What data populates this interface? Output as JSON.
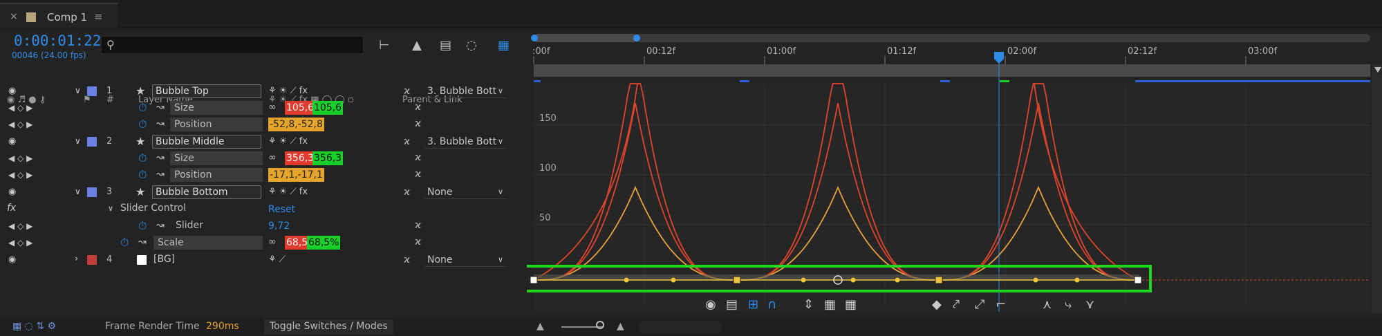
{
  "tab": {
    "close": "×",
    "label": "Comp 1",
    "menu": "≡",
    "swatch_color": "#b9a57b"
  },
  "comp": {
    "timecode": "0:00:01:22",
    "frame_info": "00046 (24.00 fps)",
    "search_placeholder": ""
  },
  "columns": {
    "layer_name": "Layer Name",
    "parent_link": "Parent & Link",
    "hash": "#"
  },
  "layers": [
    {
      "num": "1",
      "name": "Bubble Top",
      "label_color": "#6b80e6",
      "parent": "3. Bubble Bott",
      "props": [
        {
          "name": "Size",
          "values": [
            "105,6",
            "105,6"
          ],
          "colors": [
            "red",
            "green"
          ]
        },
        {
          "name": "Position",
          "values": [
            "-52,8,-52,8"
          ],
          "colors": [
            "orange"
          ]
        }
      ]
    },
    {
      "num": "2",
      "name": "Bubble Middle",
      "label_color": "#6b80e6",
      "parent": "3. Bubble Bott",
      "props": [
        {
          "name": "Size",
          "values": [
            "356,3",
            "356,3"
          ],
          "colors": [
            "red",
            "green"
          ]
        },
        {
          "name": "Position",
          "values": [
            "-17,1,-17,1"
          ],
          "colors": [
            "orange"
          ]
        }
      ]
    },
    {
      "num": "3",
      "name": "Bubble Bottom",
      "label_color": "#6b80e6",
      "parent": "None",
      "effect": "Slider Control",
      "effect_reset": "Reset",
      "props": [
        {
          "name": "Slider",
          "values": [
            "9,72"
          ],
          "colors": [
            "blue"
          ]
        },
        {
          "name": "Scale",
          "values": [
            "68,5",
            "68,5%"
          ],
          "colors": [
            "red",
            "green"
          ]
        }
      ]
    },
    {
      "num": "4",
      "name": "[BG]",
      "label_color": "#c33b3b",
      "parent": "None"
    }
  ],
  "footer": {
    "render_label": "Frame Render Time",
    "render_value": "290ms",
    "toggle_label": "Toggle Switches / Modes"
  },
  "ruler": {
    "labels": [
      ":00f",
      "00:12f",
      "01:00f",
      "01:12f",
      "02:00f",
      "02:12f",
      "03:00f"
    ]
  },
  "graph": {
    "y_labels": [
      "150",
      "100",
      "50"
    ],
    "playhead_time": "0:00:01:22",
    "highlight_color": "#1ed81e",
    "curve_colors": [
      "#e0452b",
      "#e9a23b",
      "#f0c43a"
    ]
  }
}
